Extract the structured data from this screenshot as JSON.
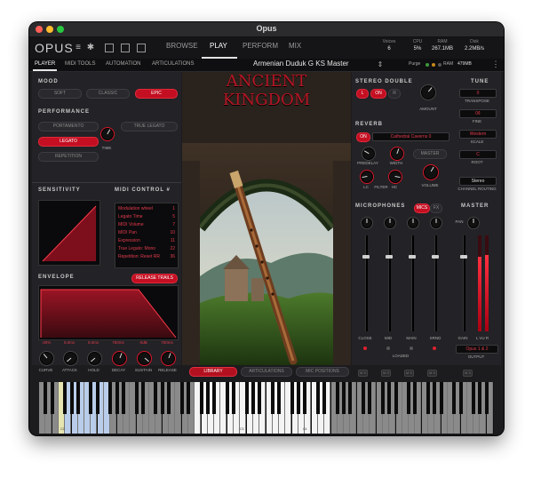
{
  "window": {
    "title": "Opus"
  },
  "topbar": {
    "logo": "OPUS",
    "tabs": [
      "BROWSE",
      "PLAY",
      "PERFORM",
      "MIX"
    ],
    "active_tab": "PLAY",
    "stats": [
      {
        "label": "Voices",
        "value": "6"
      },
      {
        "label": "CPU",
        "value": "5%"
      },
      {
        "label": "RAM",
        "value": "267.1MB"
      },
      {
        "label": "Disk",
        "value": "2.2MB/s"
      }
    ]
  },
  "subbar": {
    "tabs": [
      "PLAYER",
      "MIDI TOOLS",
      "AUTOMATION",
      "ARTICULATIONS"
    ],
    "instrument": "Armenian Duduk G KS Master",
    "purge_label": "Purge",
    "ram_label": "RAM",
    "ram_value": "479MB"
  },
  "mood": {
    "title": "MOOD",
    "options": [
      "SOFT",
      "CLASSIC",
      "EPIC"
    ],
    "selected": "EPIC"
  },
  "performance": {
    "title": "PERFORMANCE",
    "portamento": "PORTAMENTO",
    "true_legato": "TRUE LEGATO",
    "legato": "LEGATO",
    "repetition": "REPETITION",
    "time": "TIME"
  },
  "sensitivity": {
    "title": "SENSITIVITY"
  },
  "midi_control": {
    "title": "MIDI CONTROL #",
    "rows": [
      {
        "name": "Modulation wheel",
        "cc": "1"
      },
      {
        "name": "Legato Time",
        "cc": "5"
      },
      {
        "name": "MIDI Volume",
        "cc": "7"
      },
      {
        "name": "MIDI Pan",
        "cc": "10"
      },
      {
        "name": "Expression",
        "cc": "11"
      },
      {
        "name": "True Legato: Mono",
        "cc": "22"
      },
      {
        "name": "Repetition: Reset RR",
        "cc": "36"
      }
    ]
  },
  "envelope": {
    "title": "ENVELOPE",
    "release_trails": "RELEASE TRAILS",
    "values": [
      "-30%",
      "0.0ms",
      "0.0ms",
      "750ms",
      "-0dB",
      "750ms"
    ],
    "knobs": [
      "CURVE",
      "ATTACK",
      "HOLD",
      "DECAY",
      "SUSTAIN",
      "RELEASE"
    ]
  },
  "artwork": {
    "title": "ANCIENT KINGDOM"
  },
  "bottom_tabs": [
    "LIBRARY",
    "ARTICULATIONS",
    "MIC POSITIONS"
  ],
  "stereo_double": {
    "title": "STEREO DOUBLE",
    "btn_l": "L",
    "btn_on": "ON",
    "btn_r": "R",
    "amount": "AMOUNT"
  },
  "tune": {
    "title": "TUNE",
    "transpose_value": "0",
    "transpose": "TRANSPOSE",
    "fine_value": "0¢",
    "fine": "FINE",
    "scale_value": "Western",
    "scale": "SCALE",
    "root_value": "C",
    "root": "ROOT"
  },
  "reverb": {
    "title": "REVERB",
    "on": "ON",
    "preset": "Cathedral Caverns 0",
    "master": "MASTER",
    "predelay": "PREDELAY",
    "width": "WIDTH",
    "lc": "LC",
    "filter": "FILTER",
    "hc": "HC",
    "volume": "VOLUME"
  },
  "channel_routing": {
    "value": "Stereo",
    "label": "CHANNEL ROUTING"
  },
  "microphones": {
    "title": "MICROPHONES",
    "mics": "MICS",
    "fx": "FX",
    "channels": [
      "CLOSE",
      "MID",
      "MAIN",
      "SRND"
    ],
    "loaded": "LOADED"
  },
  "master": {
    "title": "MASTER",
    "pan": "PAN",
    "gain": "GAIN",
    "lvur": "L VU R",
    "output_value": "Opus 1 & 2",
    "output": "OUTPUT"
  },
  "keyboard": {
    "labels": [
      "C2",
      "C3",
      "C4"
    ]
  },
  "colors": {
    "accent": "#d6182b",
    "bg": "#1c1b1e",
    "panel": "#2b2a2e"
  }
}
